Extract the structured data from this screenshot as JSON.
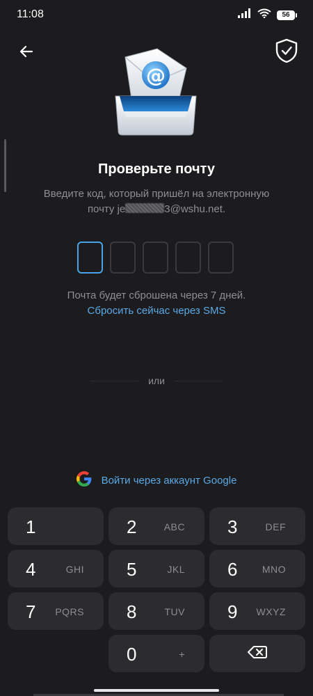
{
  "status_bar": {
    "time": "11:08",
    "battery": "56",
    "icons": [
      "signal-icon",
      "wifi-icon",
      "battery-icon"
    ]
  },
  "header": {
    "back_icon": "arrow-left-icon",
    "shield_icon": "shield-check-icon"
  },
  "main": {
    "title": "Проверьте почту",
    "subtitle_line1": "Введите код, который пришёл на электронную",
    "subtitle_prefix": "почту je",
    "subtitle_suffix": "3@wshu.net.",
    "code_length": 5,
    "reset_note": "Почта будет сброшена через 7 дней.",
    "reset_link": "Сбросить сейчас через SMS",
    "divider_text": "или",
    "google_label": "Войти через аккаунт Google"
  },
  "keypad": {
    "keys": [
      {
        "digit": "1",
        "letters": ""
      },
      {
        "digit": "2",
        "letters": "ABC"
      },
      {
        "digit": "3",
        "letters": "DEF"
      },
      {
        "digit": "4",
        "letters": "GHI"
      },
      {
        "digit": "5",
        "letters": "JKL"
      },
      {
        "digit": "6",
        "letters": "MNO"
      },
      {
        "digit": "7",
        "letters": "PQRS"
      },
      {
        "digit": "8",
        "letters": "TUV"
      },
      {
        "digit": "9",
        "letters": "WXYZ"
      },
      {
        "digit": "0",
        "letters": "+"
      }
    ]
  },
  "colors": {
    "background": "#1c1c1e",
    "accent": "#5aa9e6",
    "key_bg": "#2c2c2e",
    "muted_text": "#8e8e93"
  }
}
